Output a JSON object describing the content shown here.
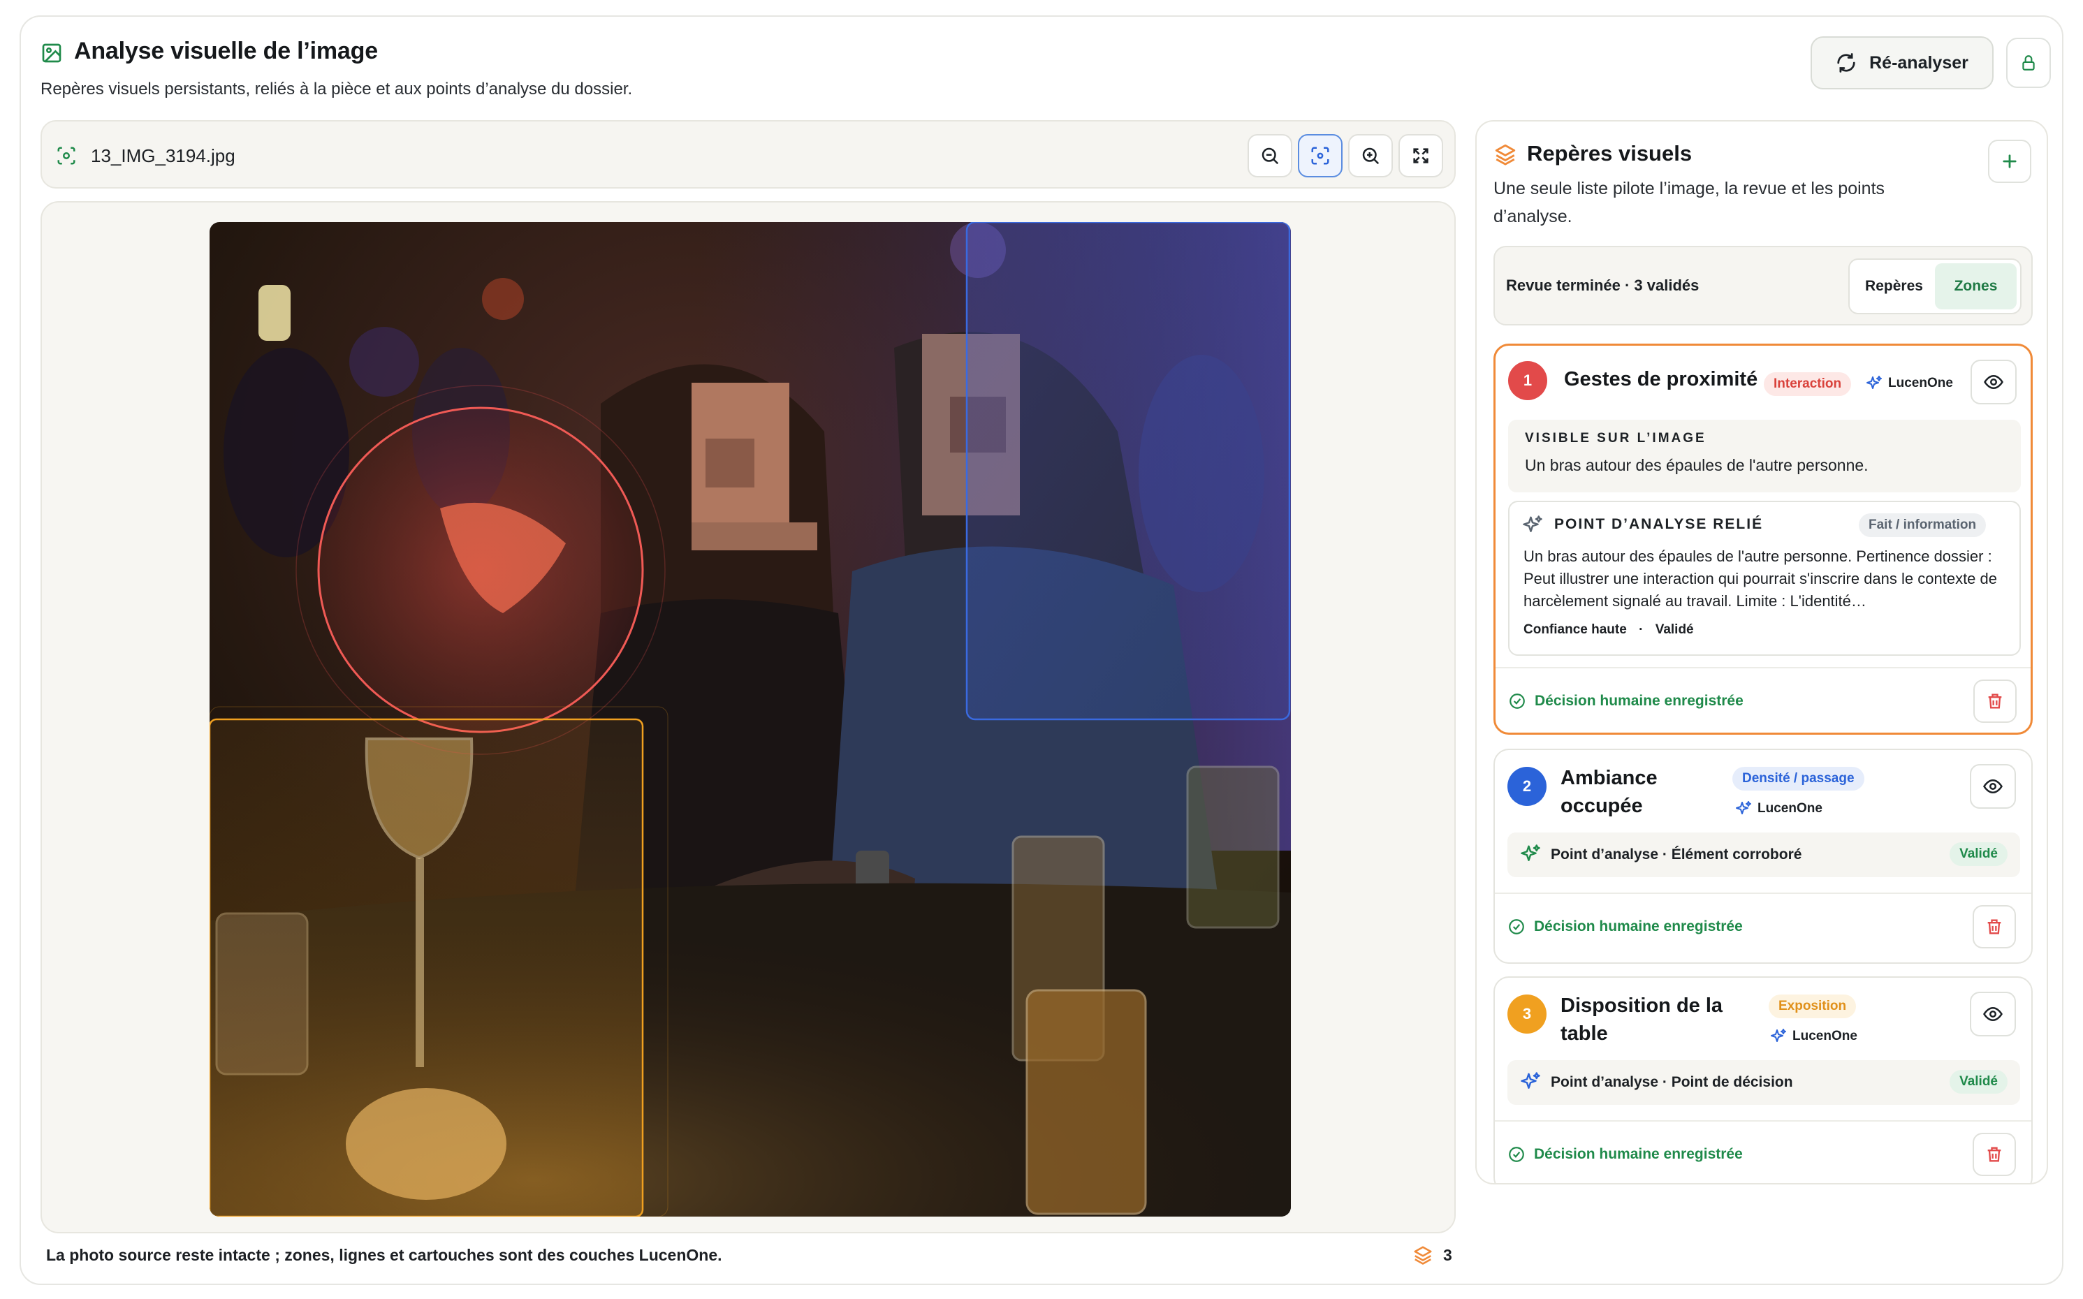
{
  "header": {
    "title": "Analyse visuelle de l’image",
    "subtitle": "Repères visuels persistants, reliés à la pièce et aux points d’analyse du dossier.",
    "reanalyse_label": "Ré-analyser"
  },
  "viewer": {
    "filename": "13_IMG_3194.jpg",
    "tools": [
      "zoom-out-icon",
      "focus-icon",
      "zoom-in-icon",
      "fullscreen-icon"
    ],
    "active_tool": "focus-icon",
    "footer_note": "La photo source reste intacte ; zones, lignes et cartouches sont des couches LucenOne.",
    "layer_count": "3"
  },
  "panel": {
    "title": "Repères visuels",
    "subtitle": "Une seule liste pilote l’image, la revue et les points d’analyse.",
    "review_status": "Revue terminée · 3 validés",
    "segments": [
      "Repères",
      "Zones"
    ],
    "active_segment": "Zones"
  },
  "markers": [
    {
      "number": "1",
      "title": "Gestes de proximité",
      "tag": "Interaction",
      "source": "LucenOne",
      "color": "#e24a4a",
      "visible_heading": "VISIBLE SUR L’IMAGE",
      "visible_text": "Un bras autour des épaules de l'autre personne.",
      "linked_heading": "POINT D’ANALYSE RELIÉ",
      "linked_tag": "Fait / information",
      "linked_text": "Un bras autour des épaules de l'autre personne. Pertinence dossier : Peut illustrer une interaction qui pourrait s'inscrire dans le contexte de harcèlement signalé au travail. Limite : L'identité…",
      "confidence": "Confiance haute",
      "status": "Validé",
      "decision": "Décision humaine enregistrée"
    },
    {
      "number": "2",
      "title": "Ambiance occupée",
      "tag": "Densité / passage",
      "source": "LucenOne",
      "color": "#2b63d9",
      "analysis": "Point d’analyse · Élément corroboré",
      "status": "Validé",
      "decision": "Décision humaine enregistrée"
    },
    {
      "number": "3",
      "title": "Disposition de la table",
      "tag": "Exposition",
      "source": "LucenOne",
      "color": "#f0a020",
      "analysis": "Point d’analyse · Point de décision",
      "status": "Validé",
      "decision": "Décision humaine enregistrée"
    }
  ]
}
